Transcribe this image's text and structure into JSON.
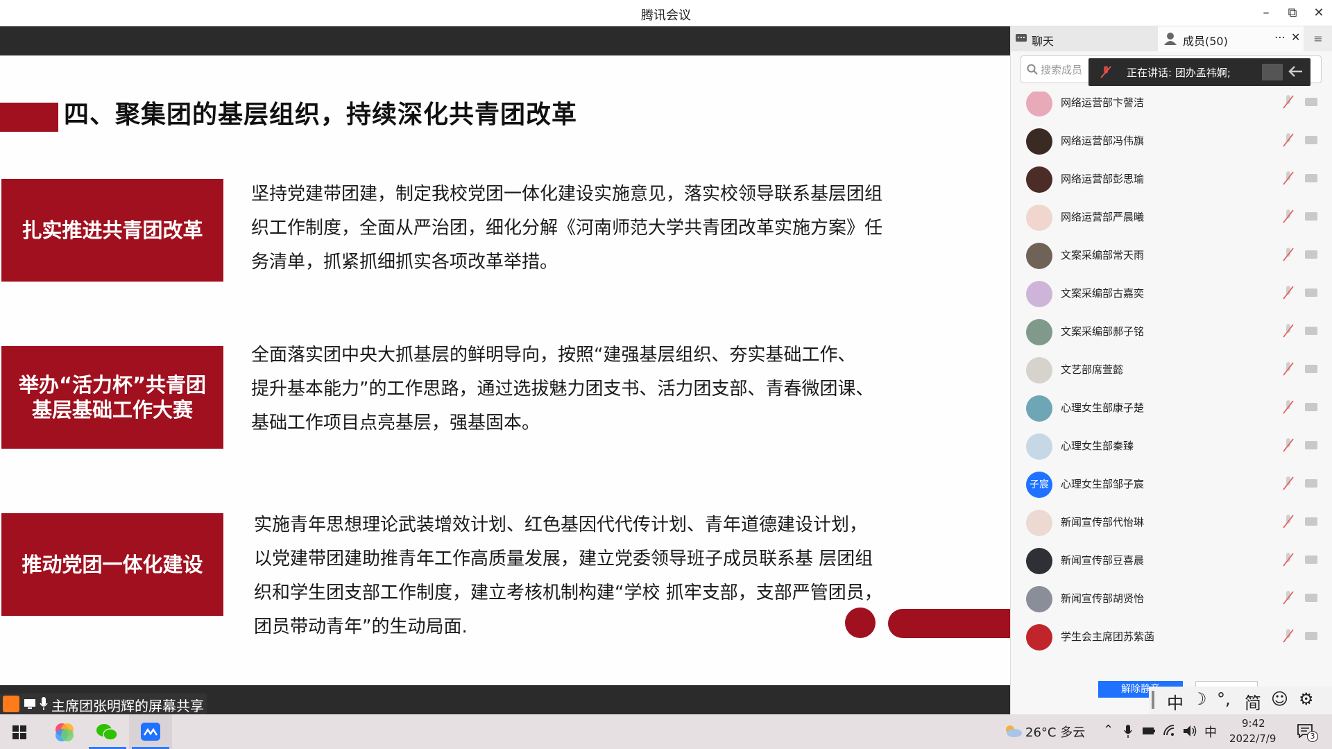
{
  "window": {
    "title": "腾讯会议"
  },
  "slide": {
    "heading": "四、聚集团的基层组织，持续深化共青团改革",
    "items": [
      {
        "label": "扎实推进共青团改革",
        "text": "坚持党建带团建，制定我校党团一体化建设实施意见，落实校领导联系基层团组\n织工作制度，全面从严治团，细化分解《河南师范大学共青团改革实施方案》任\n务清单，抓紧抓细抓实各项改革举措。"
      },
      {
        "label": "举办“活力杯”共青团\n基层基础工作大赛",
        "text": "全面落实团中央大抓基层的鲜明导向，按照“建强基层组织、夯实基础工作、\n提升基本能力”的工作思路，通过选拔魅力团支书、活力团支部、青春微团课、\n基础工作项目点亮基层，强基固本。"
      },
      {
        "label": "推动党团一体化建设",
        "text": "实施青年思想理论武装增效计划、红色基因代代传计划、青年道德建设计划，\n以党建带团建助推青年工作高质量发展，建立党委领导班子成员联系基 层团组\n织和学生团支部工作制度，建立考核机制构建“学校 抓牢支部，支部严管团员，\n团员带动青年”的生动局面."
      }
    ],
    "accent_color": "#a0101f"
  },
  "presenter_bar": {
    "text": "主席团张明辉的屏幕共享"
  },
  "panel": {
    "tab_chat": "聊天",
    "tab_members": "成员(50)",
    "search_placeholder": "搜索成员",
    "speaking": "正在讲话: 团办孟祎婀;",
    "members": [
      {
        "name": "网络运营部卞謦洁",
        "avatar_color": "#e8a9b8",
        "avatar_text": ""
      },
      {
        "name": "网络运营部冯伟旗",
        "avatar_color": "#3a2a24",
        "avatar_text": ""
      },
      {
        "name": "网络运营部彭思瑜",
        "avatar_color": "#4b2c26",
        "avatar_text": ""
      },
      {
        "name": "网络运营部严晨曦",
        "avatar_color": "#f0d6cc",
        "avatar_text": ""
      },
      {
        "name": "文案采编部常天雨",
        "avatar_color": "#6f6358",
        "avatar_text": ""
      },
      {
        "name": "文案采编部古嘉奕",
        "avatar_color": "#cfb4d9",
        "avatar_text": ""
      },
      {
        "name": "文案采编部郝子铭",
        "avatar_color": "#7f9a8a",
        "avatar_text": ""
      },
      {
        "name": "文艺部席萱懿",
        "avatar_color": "#d6d2cc",
        "avatar_text": ""
      },
      {
        "name": "心理女生部康子楚",
        "avatar_color": "#6fa6b5",
        "avatar_text": ""
      },
      {
        "name": "心理女生部秦臻",
        "avatar_color": "#c6d8e6",
        "avatar_text": ""
      },
      {
        "name": "心理女生部邹子宸",
        "avatar_color": "#1e72ff",
        "avatar_text": "子宸"
      },
      {
        "name": "新闻宣传部代怡琳",
        "avatar_color": "#ecd9d2",
        "avatar_text": ""
      },
      {
        "name": "新闻宣传部豆喜晨",
        "avatar_color": "#2f3035",
        "avatar_text": ""
      },
      {
        "name": "新闻宣传部胡贤怡",
        "avatar_color": "#8a8e99",
        "avatar_text": ""
      },
      {
        "name": "学生会主席团苏紫菡",
        "avatar_color": "#c0252b",
        "avatar_text": ""
      }
    ],
    "unmute_label": "解除静音"
  },
  "ime": {
    "lang": "中",
    "moon": "☽",
    "punct": "°,",
    "simplified": "简",
    "emoji": "☺",
    "settings": "⚙"
  },
  "taskbar": {
    "weather": "26°C 多云",
    "ime_indicator": "中",
    "time": "9:42",
    "date": "2022/7/9",
    "notifications": "3"
  }
}
